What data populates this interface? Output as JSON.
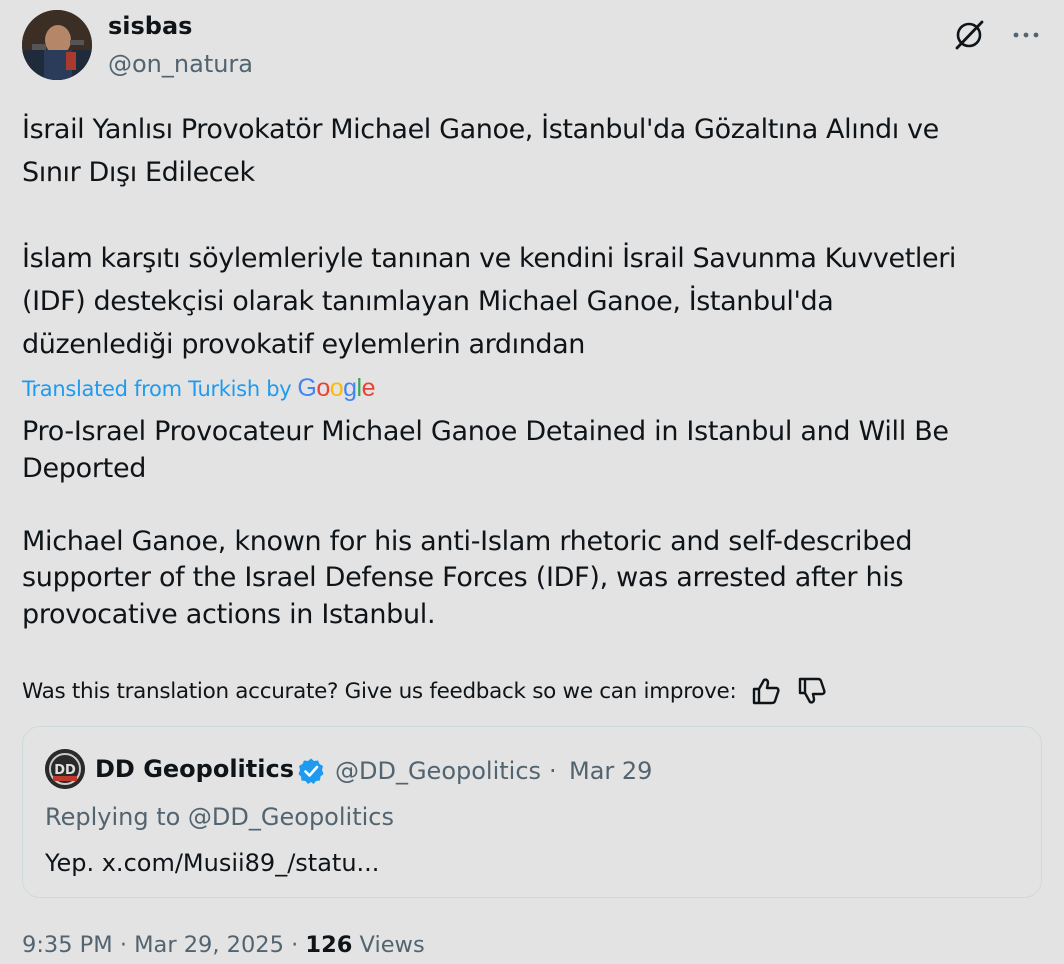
{
  "author": {
    "display_name": "sisbas",
    "handle": "@on_natura"
  },
  "tweet": {
    "text": "İsrail Yanlısı Provokatör Michael Ganoe, İstanbul'da Gözaltına Alındı ve\nSınır Dışı Edilecek\n\nİslam karşıtı söylemleriyle tanınan ve kendini İsrail Savunma Kuvvetleri\n(IDF) destekçisi olarak tanımlayan Michael Ganoe, İstanbul'da\ndüzenlediği provokatif eylemlerin ardından",
    "translated_label": "Translated from Turkish by",
    "translation": "Pro-Israel Provocateur Michael Ganoe Detained in Istanbul and Will Be\nDeported\n\nMichael Ganoe, known for his anti-Islam rhetoric and self-described\nsupporter of the Israel Defense Forces (IDF), was arrested after his\nprovocative actions in Istanbul.",
    "feedback_prompt": "Was this translation accurate? Give us feedback so we can improve:"
  },
  "google_logo": {
    "letters": [
      "G",
      "o",
      "o",
      "g",
      "l",
      "e"
    ],
    "colors": [
      "#4285F4",
      "#EA4335",
      "#FBBC05",
      "#4285F4",
      "#34A853",
      "#EA4335"
    ]
  },
  "quote": {
    "avatar_text": "DD",
    "name": "DD Geopolitics",
    "handle": "@DD_Geopolitics",
    "separator": "·",
    "date": "Mar 29",
    "replying": "Replying to @DD_Geopolitics",
    "body": "Yep. x.com/Musii89_/statu..."
  },
  "meta": {
    "time": "9:35 PM",
    "separator": "·",
    "date": "Mar 29, 2025",
    "views_count": "126",
    "views_label": "Views"
  },
  "colors": {
    "background": "#e3e3e3",
    "text": "#0f1419",
    "secondary": "#536471",
    "link": "#1d9bf0",
    "verified": "#1d9bf0",
    "border": "#cfd9de"
  },
  "icons": {
    "grok": "grok-icon",
    "more": "more-icon",
    "thumbs_up": "thumbs-up-icon",
    "thumbs_down": "thumbs-down-icon",
    "verified": "verified-badge-icon"
  }
}
